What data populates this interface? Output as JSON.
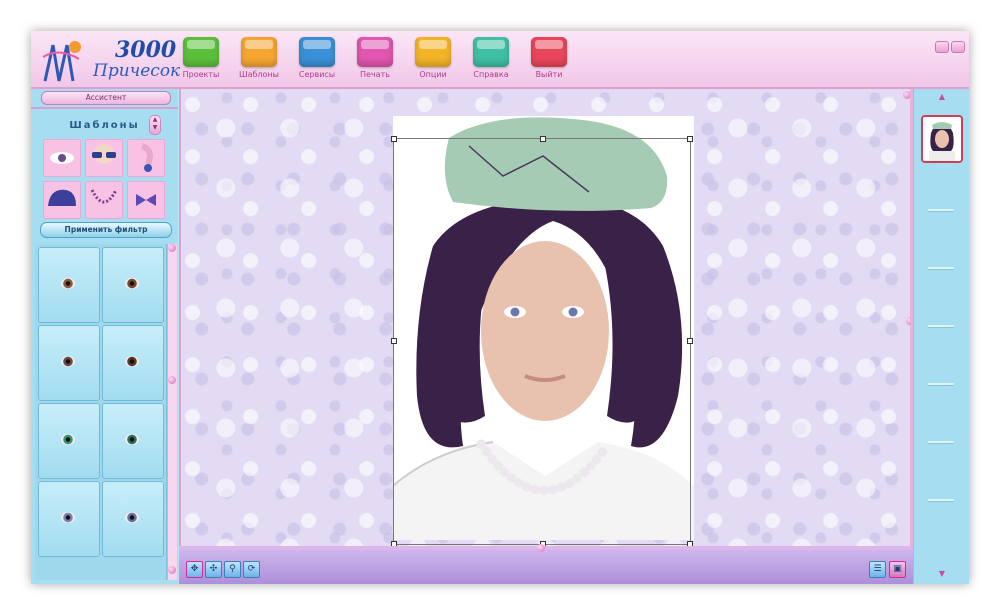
{
  "app": {
    "logo_number": "3000",
    "logo_text": "Причесок"
  },
  "toolbar": {
    "items": [
      {
        "label": "Проекты",
        "color": "#5cbf3c",
        "icon": "projects-icon"
      },
      {
        "label": "Шаблоны",
        "color": "#f5a531",
        "icon": "templates-icon"
      },
      {
        "label": "Сервисы",
        "color": "#3a8fd6",
        "icon": "services-icon"
      },
      {
        "label": "Печать",
        "color": "#e056b0",
        "icon": "print-icon"
      },
      {
        "label": "Опции",
        "color": "#f3b327",
        "icon": "options-icon"
      },
      {
        "label": "Справка",
        "color": "#3fbfa3",
        "icon": "help-icon"
      },
      {
        "label": "Выйти",
        "color": "#e8455a",
        "icon": "exit-icon"
      }
    ]
  },
  "left_panel": {
    "assistant_label": "Ассистент",
    "templates_title": "Шаблоны",
    "apply_filter_label": "Применить фильтр",
    "template_icons": [
      "eye-makeup-icon",
      "sunglasses-icon",
      "earring-icon",
      "cap-icon",
      "necklace-icon",
      "bowtie-icon"
    ],
    "eye_colors": [
      "#8a5a3b",
      "#7b4a2a",
      "#6a4a4a",
      "#5a3b2a",
      "#3e8f6f",
      "#2f6f5a",
      "#7c7fb8",
      "#6a6fa8"
    ]
  },
  "colors": {
    "header_bg": "#f1c7e8",
    "panel_bg": "#a6ddf0",
    "canvas_bg": "#e2dbf3",
    "selected_border": "#cc3f59"
  }
}
